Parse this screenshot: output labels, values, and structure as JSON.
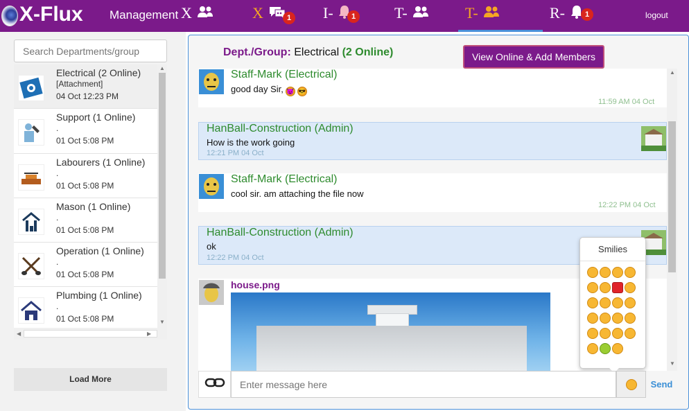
{
  "topbar": {
    "app_name": "X-Flux",
    "management_label": "Management",
    "nav": [
      {
        "label": "X",
        "icon": "group-icon",
        "badge": ""
      },
      {
        "label": "X",
        "icon": "chat-icon",
        "badge": "1"
      },
      {
        "label": "I-",
        "icon": "bell-icon",
        "badge": "1"
      },
      {
        "label": "T-",
        "icon": "group-icon",
        "badge": ""
      },
      {
        "label": "T-",
        "icon": "group-icon",
        "badge": ""
      },
      {
        "label": "R-",
        "icon": "bell-icon",
        "badge": "1"
      }
    ],
    "logout_label": "logout",
    "colors": {
      "bar": "#7b1a8a",
      "active": "#f5a623",
      "badge": "#d9251d"
    }
  },
  "sidebar": {
    "search_placeholder": "Search Departments/group",
    "departments": [
      {
        "name": "Electrical (2 Online)",
        "sub": "[Attachment]",
        "time": "04 Oct 12:23 PM",
        "icon": "electrical-icon"
      },
      {
        "name": "Support (1 Online)",
        "sub": ".",
        "time": "01 Oct 5:08 PM",
        "icon": "support-icon"
      },
      {
        "name": "Labourers (1 Online)",
        "sub": ".",
        "time": "01 Oct 5:08 PM",
        "icon": "labourers-icon"
      },
      {
        "name": "Mason (1 Online)",
        "sub": ".",
        "time": "01 Oct 5:08 PM",
        "icon": "mason-icon"
      },
      {
        "name": "Operation (1 Online)",
        "sub": ".",
        "time": "01 Oct 5:08 PM",
        "icon": "operation-icon"
      },
      {
        "name": "Plumbing (1 Online)",
        "sub": ".",
        "time": "01 Oct 5:08 PM",
        "icon": "plumbing-icon"
      }
    ],
    "load_more": "Load More"
  },
  "chat": {
    "header_label": "Dept./Group:",
    "group_name": "Electrical",
    "online": "(2 Online)",
    "view_button": "View Online & Add Members",
    "messages": [
      {
        "sender": "Staff-Mark (Electrical)",
        "text": "good day Sir,",
        "time": "11:59 AM 04 Oct"
      },
      {
        "sender": "HanBall-Construction (Admin)",
        "text": "How is the work going",
        "time": "12:21 PM 04 Oct"
      },
      {
        "sender": "Staff-Mark (Electrical)",
        "text": "cool sir. am attaching the file now",
        "time": "12:22 PM 04 Oct"
      },
      {
        "sender": "HanBall-Construction (Admin)",
        "text": "ok",
        "time": "12:22 PM 04 Oct"
      },
      {
        "sender": "house.png",
        "text": "",
        "time": ""
      }
    ],
    "smilies_title": "Smilies",
    "input_placeholder": "Enter message here",
    "send_label": "Send"
  }
}
